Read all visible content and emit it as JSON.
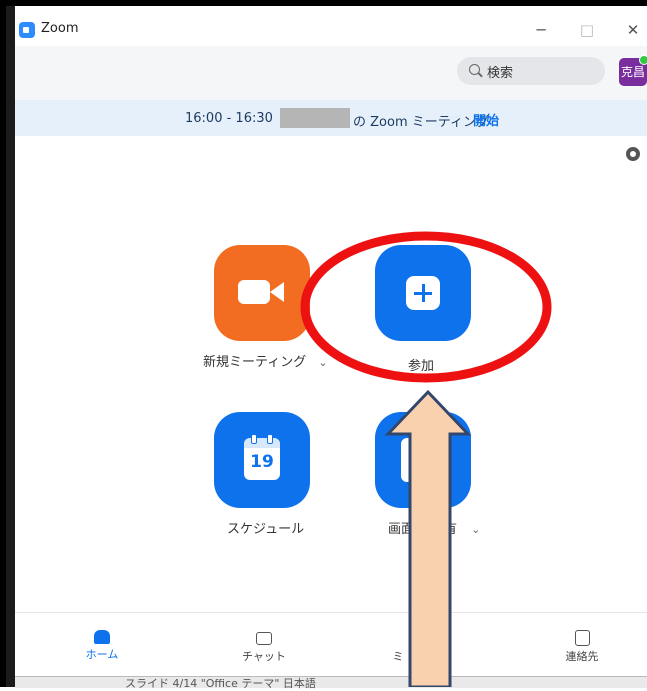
{
  "window": {
    "title": "Zoom",
    "minimize": "─",
    "maximize": "□",
    "close": "✕"
  },
  "topbar": {
    "search_label": "検索",
    "avatar_text": "克昌"
  },
  "banner": {
    "time": "16:00 - 16:30",
    "meeting_text": "の Zoom ミーティング",
    "start_label": "開始"
  },
  "actions": {
    "new_meeting": "新規ミーティング",
    "new_meeting_chevron": "⌄",
    "join": "参加",
    "schedule": "スケジュール",
    "schedule_day": "19",
    "share_screen": "画面",
    "share_screen_tail": "有",
    "share_chevron": "⌄"
  },
  "nav": {
    "home": "ホーム",
    "chat": "チャット",
    "meetings": "ミ",
    "contacts": "連絡先"
  },
  "taskbar": {
    "text": "スライド 4/14   \"Office テーマ\"   日本語"
  },
  "colors": {
    "accent": "#0e72ed",
    "new_meeting": "#f26d21",
    "annotation_circle": "#ee1111",
    "annotation_arrow": "#fad1ae"
  }
}
